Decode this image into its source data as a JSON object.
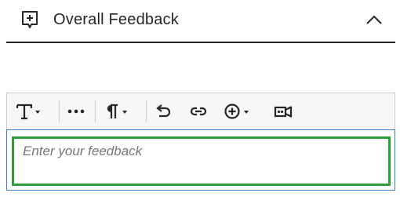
{
  "section": {
    "title": "Overall Feedback",
    "icon": "add-comment-icon",
    "collapse_icon": "chevron-up-icon"
  },
  "editor": {
    "placeholder": "Enter your feedback",
    "toolbar": [
      {
        "name": "text-format",
        "icon": "text-format-icon",
        "has_dropdown": true
      },
      {
        "name": "more-options",
        "icon": "ellipsis-icon",
        "has_dropdown": false
      },
      {
        "name": "paragraph",
        "icon": "pilcrow-icon",
        "has_dropdown": true
      },
      {
        "name": "undo",
        "icon": "undo-icon",
        "has_dropdown": false
      },
      {
        "name": "insert-link",
        "icon": "link-icon",
        "has_dropdown": false
      },
      {
        "name": "insert-content",
        "icon": "plus-circle-icon",
        "has_dropdown": true
      },
      {
        "name": "record-video",
        "icon": "video-camera-icon",
        "has_dropdown": false
      }
    ]
  },
  "colors": {
    "text": "#262626",
    "focus_ring": "#2a9d3a",
    "editor_border": "#2f80c8",
    "toolbar_bg": "#f7f7f7"
  }
}
